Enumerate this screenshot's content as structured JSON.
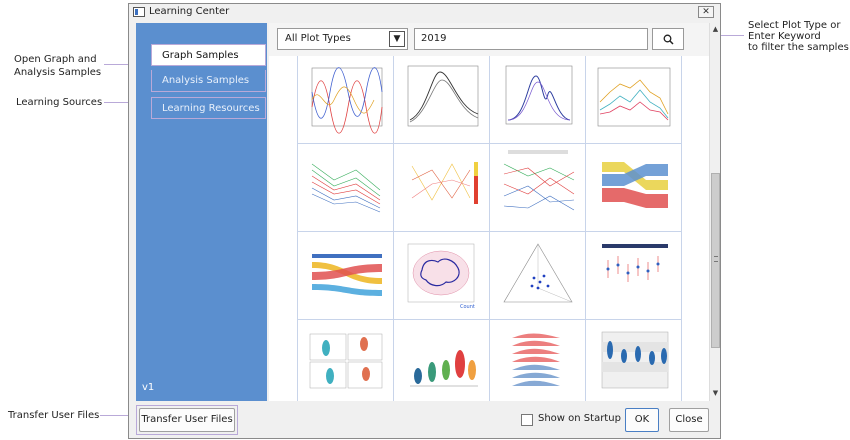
{
  "window": {
    "title": "Learning Center"
  },
  "sidebar": {
    "items": [
      {
        "label": "Graph Samples"
      },
      {
        "label": "Analysis Samples"
      },
      {
        "label": "Learning Resources"
      }
    ],
    "version": "v1"
  },
  "filter": {
    "plot_type": "All Plot Types",
    "keyword": "2019"
  },
  "footer": {
    "transfer_label": "Transfer User Files",
    "startup_label": "Show on Startup",
    "startup_checked": false,
    "ok_label": "OK",
    "close_label": "Close"
  },
  "callouts": {
    "open_graph_1": "Open Graph and",
    "open_graph_2": "Analysis Samples",
    "learning_sources": "Learning Sources",
    "transfer": "Transfer User Files",
    "select_1": "Select Plot Type or",
    "select_2": "Enter Keyword",
    "select_3": "to filter the samples"
  },
  "samples": [
    "line-graph-sample",
    "peak-fit-sample",
    "spectrum-fit-sample",
    "multi-line-sample",
    "parallel-coordinates-sample",
    "parallel-heatmap-sample",
    "parallel-lines-sample",
    "parallel-sets-sample",
    "sankey-sample",
    "polar-contour-sample",
    "ternary-scatter-sample",
    "dot-error-sample",
    "violin-panel-sample",
    "violin-box-sample",
    "ridgeline-sample",
    "split-violin-sample"
  ]
}
